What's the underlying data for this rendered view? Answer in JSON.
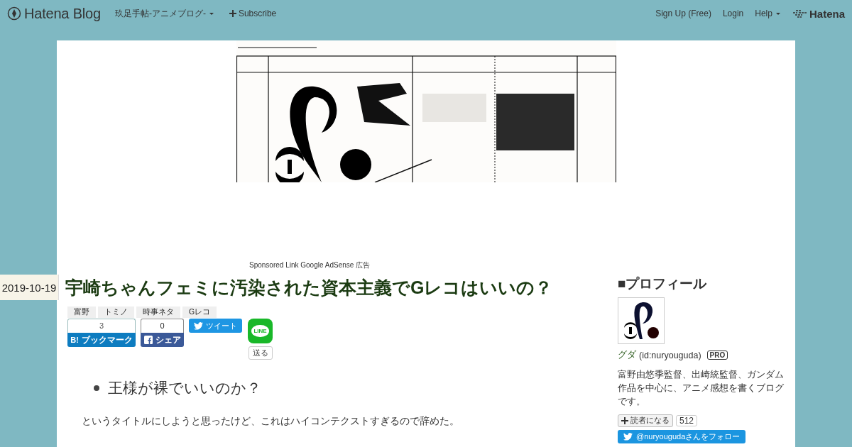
{
  "topbar": {
    "brand": "Hatena Blog",
    "blog_menu": "玖足手帖-アニメブログ-",
    "subscribe": "Subscribe",
    "links": [
      "Sign Up (Free)",
      "Login",
      "Help"
    ],
    "hatena": "Hatena"
  },
  "ad_label": "Sponsored Link Google AdSense 広告",
  "entry": {
    "date": "2019-10-19",
    "title": "宇崎ちゃんフェミに汚染された資本主義でGレコはいいの？",
    "tags": [
      "富野",
      "トミノ",
      "時事ネタ",
      "Gレコ"
    ],
    "share": {
      "bookmark_count": "3",
      "bookmark_label": "ブックマーク",
      "bookmark_logo": "B!",
      "facebook_count": "0",
      "facebook_label": "シェア",
      "tweet_label": "ツイート",
      "line_logo": "LINE",
      "line_label": "送る"
    },
    "bullets": [
      "王様が裸でいいのか？"
    ],
    "paragraph": "というタイトルにしようと思ったけど、これはハイコンテクストすぎるので辞めた。"
  },
  "sidebar": {
    "heading": "■プロフィール",
    "name": "グダ",
    "id": "(id:nuryouguda)",
    "badge": "PRO",
    "description": "富野由悠季監督、出崎統監督、ガンダム作品を中心に、アニメ感想を書くブログです。",
    "reader_button": "読者になる",
    "reader_count": "512",
    "twitter_follow": "@nuryougudaさんをフォロー"
  }
}
